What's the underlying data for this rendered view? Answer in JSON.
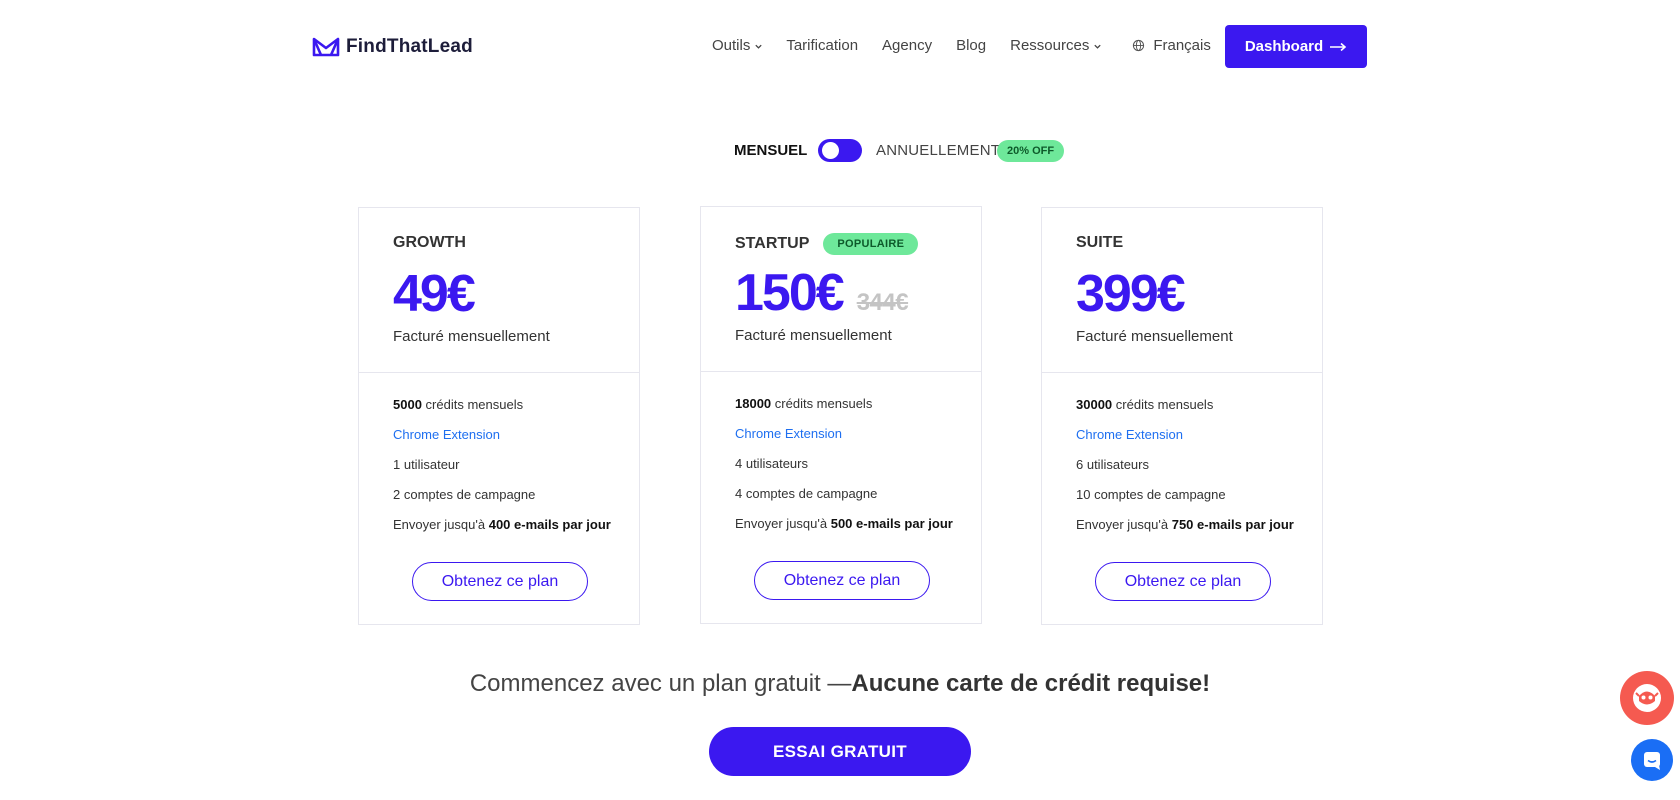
{
  "header": {
    "logo_text": "FindThatLead",
    "nav": {
      "outils": "Outils",
      "tarification": "Tarification",
      "agency": "Agency",
      "blog": "Blog",
      "ressources": "Ressources",
      "language": "Français"
    },
    "dashboard_label": "Dashboard"
  },
  "billing_toggle": {
    "monthly_label": "MENSUEL",
    "annual_label": "ANNUELLEMENT",
    "discount_badge": "20% OFF",
    "selected": "MENSUEL"
  },
  "plans": [
    {
      "name": "GROWTH",
      "badge": "",
      "price": "49€",
      "old_price": "",
      "billing": "Facturé mensuellement",
      "credits_value": "5000",
      "credits_label": "crédits mensuels",
      "extension": "Chrome Extension",
      "users": "1 utilisateur",
      "campaigns": "2 comptes de campagne",
      "send_prefix": "Envoyer jusqu'à",
      "send_value": "400 e-mails par jour",
      "cta": "Obtenez ce plan"
    },
    {
      "name": "STARTUP",
      "badge": "POPULAIRE",
      "price": "150€",
      "old_price": "344€",
      "billing": "Facturé mensuellement",
      "credits_value": "18000",
      "credits_label": "crédits mensuels",
      "extension": "Chrome Extension",
      "users": "4 utilisateurs",
      "campaigns": "4 comptes de campagne",
      "send_prefix": "Envoyer jusqu'à",
      "send_value": "500 e-mails par jour",
      "cta": "Obtenez ce plan"
    },
    {
      "name": "SUITE",
      "badge": "",
      "price": "399€",
      "old_price": "",
      "billing": "Facturé mensuellement",
      "credits_value": "30000",
      "credits_label": "crédits mensuels",
      "extension": "Chrome Extension",
      "users": "6 utilisateurs",
      "campaigns": "10 comptes de campagne",
      "send_prefix": "Envoyer jusqu'à",
      "send_value": "750 e-mails par jour",
      "cta": "Obtenez ce plan"
    }
  ],
  "free_plan": {
    "text_start": "Commencez avec un plan gratuit —",
    "text_bold": "Aucune carte de crédit requise!",
    "cta": "ESSAI GRATUIT"
  },
  "colors": {
    "brand": "#3b18f0",
    "badge_green": "#6ee89a",
    "link_blue": "#1e6ff0",
    "bot_red": "#f55a50",
    "chat_blue": "#1a6ef5"
  },
  "icons": {
    "logo": "findthatlead-logo-icon",
    "chevron": "chevron-down-icon",
    "globe": "globe-icon",
    "arrow": "arrow-right-icon",
    "bot": "bot-icon",
    "chat": "chat-icon"
  }
}
